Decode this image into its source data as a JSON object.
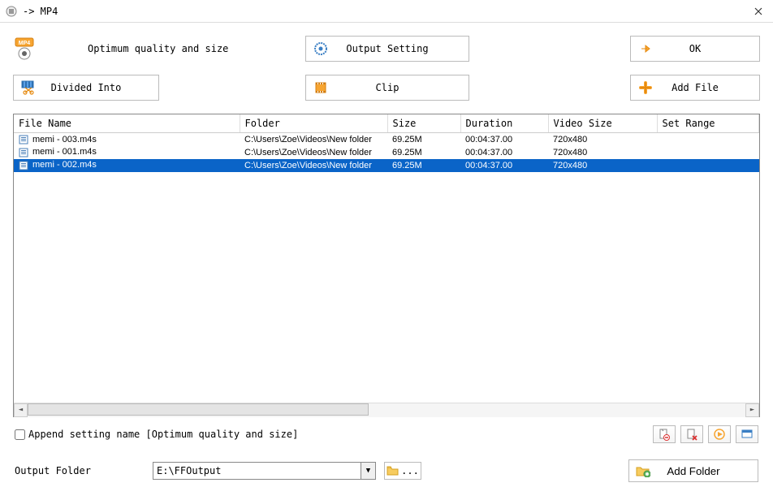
{
  "titlebar": {
    "title": " -> MP4"
  },
  "toolbar": {
    "quality_label": "Optimum quality and size",
    "divided_into_label": "Divided Into",
    "output_setting_label": "Output Setting",
    "clip_label": "Clip",
    "ok_label": "OK",
    "add_file_label": "Add File"
  },
  "list": {
    "headers": {
      "filename": "File Name",
      "folder": "Folder",
      "size": "Size",
      "duration": "Duration",
      "videosize": "Video Size",
      "setrange": "Set Range"
    },
    "rows": [
      {
        "filename": "memi - 003.m4s",
        "folder": "C:\\Users\\Zoe\\Videos\\New folder",
        "size": "69.25M",
        "duration": "00:04:37.00",
        "videosize": "720x480",
        "setrange": "",
        "selected": false
      },
      {
        "filename": "memi - 001.m4s",
        "folder": "C:\\Users\\Zoe\\Videos\\New folder",
        "size": "69.25M",
        "duration": "00:04:37.00",
        "videosize": "720x480",
        "setrange": "",
        "selected": false
      },
      {
        "filename": "memi - 002.m4s",
        "folder": "C:\\Users\\Zoe\\Videos\\New folder",
        "size": "69.25M",
        "duration": "00:04:37.00",
        "videosize": "720x480",
        "setrange": "",
        "selected": true
      }
    ]
  },
  "options": {
    "append_setting_label": "Append setting name [Optimum quality and size]"
  },
  "output": {
    "label": "Output Folder",
    "value": "E:\\FFOutput",
    "browse_ellipsis": "...",
    "add_folder_label": "Add Folder"
  }
}
